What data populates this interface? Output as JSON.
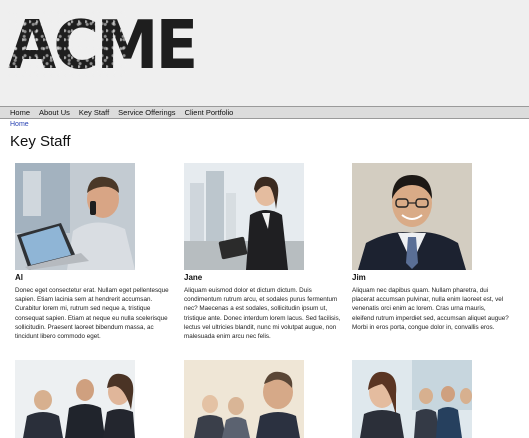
{
  "brand": {
    "logo_text": "ACME"
  },
  "nav": {
    "items": [
      "Home",
      "About Us",
      "Key Staff",
      "Service Offerings",
      "Client Portfolio"
    ]
  },
  "breadcrumb": {
    "home": "Home"
  },
  "page": {
    "title": "Key Staff"
  },
  "staff": [
    {
      "name": "Al",
      "bio": "Donec eget consectetur erat. Nullam eget pellentesque sapien. Etiam lacinia sem at hendrerit accumsan. Curabitur lorem mi, rutrum sed neque a, tristique consequat sapien. Etiam at neque eu nulla scelerisque sollicitudin. Praesent laoreet bibendum massa, ac tincidunt libero commodo eget."
    },
    {
      "name": "Jane",
      "bio": "Aliquam euismod dolor et dictum dictum. Duis condimentum rutrum arcu, et sodales purus fermentum nec? Maecenas a est sodales, sollicitudin ipsum ut, tristique ante. Donec interdum lorem lacus. Sed facilisis, lectus vel ultricies blandit, nunc mi volutpat augue, non malesuada enim arcu nec felis."
    },
    {
      "name": "Jim",
      "bio": "Aliquam nec dapibus quam. Nullam pharetra, dui placerat accumsan pulvinar, nulla enim laoreet est, vel venenatis orci enim ac lorem. Cras urna mauris, eleifend rutrum imperdiet sed, accumsan aliquet augue? Morbi in eros porta, congue dolor in, convallis eros."
    }
  ],
  "colors": {
    "header_bg": "#efefef",
    "nav_bg": "#dcdcdc",
    "link": "#2a44b4"
  }
}
